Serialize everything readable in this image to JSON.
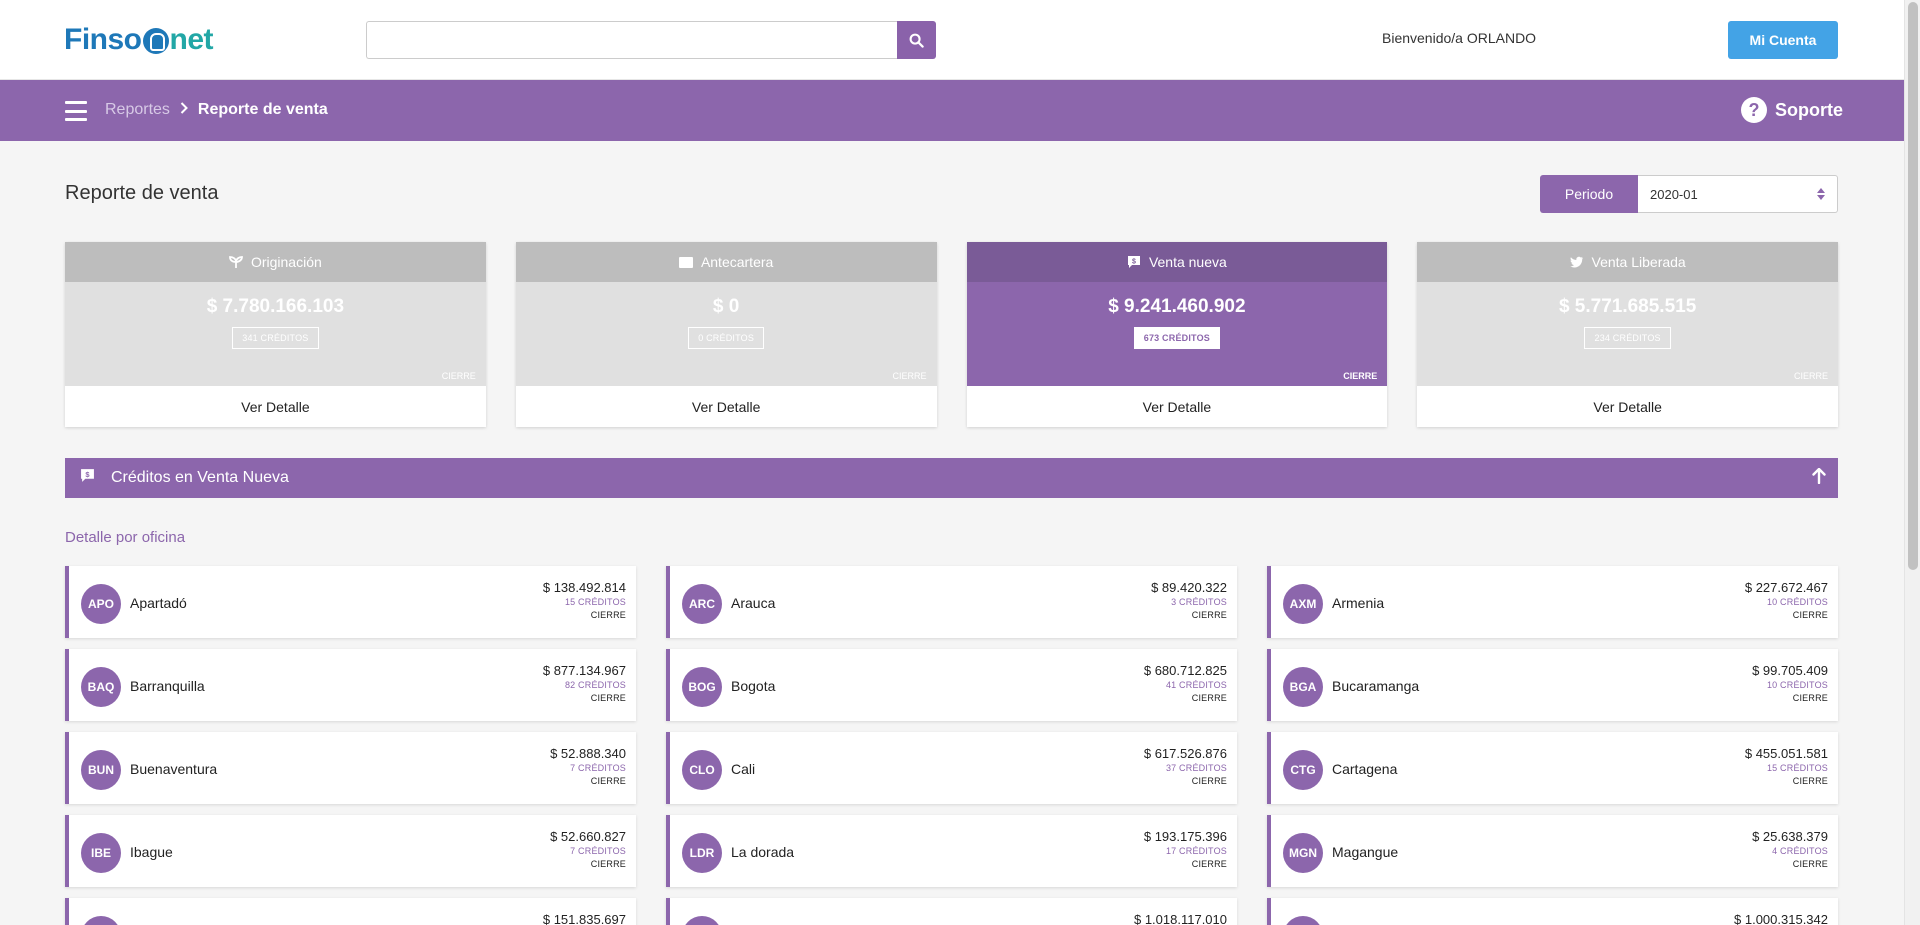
{
  "header": {
    "logo_left": "Finso",
    "logo_right": "net",
    "search": {
      "placeholder": "",
      "value": ""
    },
    "welcome": "Bienvenido/a ORLANDO",
    "account_button": "Mi Cuenta"
  },
  "nav": {
    "breadcrumb_parent": "Reportes",
    "breadcrumb_current": "Reporte de venta",
    "support_label": "Soporte"
  },
  "page": {
    "title": "Reporte de venta",
    "period_label": "Periodo",
    "period_value": "2020-01"
  },
  "cards": [
    {
      "title": "Originación",
      "icon": "sprout-icon",
      "amount": "$ 7.780.166.103",
      "badge": "341 CRÉDITOS",
      "cierre": "CIERRE",
      "link": "Ver Detalle",
      "active": false
    },
    {
      "title": "Antecartera",
      "icon": "folder-icon",
      "amount": "$ 0",
      "badge": "0 CRÉDITOS",
      "cierre": "CIERRE",
      "link": "Ver Detalle",
      "active": false
    },
    {
      "title": "Venta nueva",
      "icon": "money-chat-icon",
      "amount": "$ 9.241.460.902",
      "badge": "673 CRÉDITOS",
      "cierre": "CIERRE",
      "link": "Ver Detalle",
      "active": true
    },
    {
      "title": "Venta Liberada",
      "icon": "bird-icon",
      "amount": "$ 5.771.685.515",
      "badge": "234 CRÉDITOS",
      "cierre": "CIERRE",
      "link": "Ver Detalle",
      "active": false
    }
  ],
  "section": {
    "title": "Créditos en Venta Nueva",
    "detail_label": "Detalle por oficina"
  },
  "offices": [
    {
      "code": "APO",
      "name": "Apartadó",
      "amount": "$ 138.492.814",
      "credits": "15 CRÉDITOS",
      "cierre": "CIERRE"
    },
    {
      "code": "ARC",
      "name": "Arauca",
      "amount": "$ 89.420.322",
      "credits": "3 CRÉDITOS",
      "cierre": "CIERRE"
    },
    {
      "code": "AXM",
      "name": "Armenia",
      "amount": "$ 227.672.467",
      "credits": "10 CRÉDITOS",
      "cierre": "CIERRE"
    },
    {
      "code": "BAQ",
      "name": "Barranquilla",
      "amount": "$ 877.134.967",
      "credits": "82 CRÉDITOS",
      "cierre": "CIERRE"
    },
    {
      "code": "BOG",
      "name": "Bogota",
      "amount": "$ 680.712.825",
      "credits": "41 CRÉDITOS",
      "cierre": "CIERRE"
    },
    {
      "code": "BGA",
      "name": "Bucaramanga",
      "amount": "$ 99.705.409",
      "credits": "10 CRÉDITOS",
      "cierre": "CIERRE"
    },
    {
      "code": "BUN",
      "name": "Buenaventura",
      "amount": "$ 52.888.340",
      "credits": "7 CRÉDITOS",
      "cierre": "CIERRE"
    },
    {
      "code": "CLO",
      "name": "Cali",
      "amount": "$ 617.526.876",
      "credits": "37 CRÉDITOS",
      "cierre": "CIERRE"
    },
    {
      "code": "CTG",
      "name": "Cartagena",
      "amount": "$ 455.051.581",
      "credits": "15 CRÉDITOS",
      "cierre": "CIERRE"
    },
    {
      "code": "IBE",
      "name": "Ibague",
      "amount": "$ 52.660.827",
      "credits": "7 CRÉDITOS",
      "cierre": "CIERRE"
    },
    {
      "code": "LDR",
      "name": "La dorada",
      "amount": "$ 193.175.396",
      "credits": "17 CRÉDITOS",
      "cierre": "CIERRE"
    },
    {
      "code": "MGN",
      "name": "Magangue",
      "amount": "$ 25.638.379",
      "credits": "4 CRÉDITOS",
      "cierre": "CIERRE"
    },
    {
      "code": "",
      "name": "",
      "amount": "$ 151.835.697",
      "credits": "",
      "cierre": ""
    },
    {
      "code": "",
      "name": "",
      "amount": "$ 1.018.117.010",
      "credits": "",
      "cierre": ""
    },
    {
      "code": "",
      "name": "",
      "amount": "$ 1.000.315.342",
      "credits": "",
      "cierre": ""
    }
  ],
  "colors": {
    "brand_purple": "#8c66ac",
    "header_purple_dark": "#7a5b97",
    "account_blue": "#43a3e6"
  }
}
